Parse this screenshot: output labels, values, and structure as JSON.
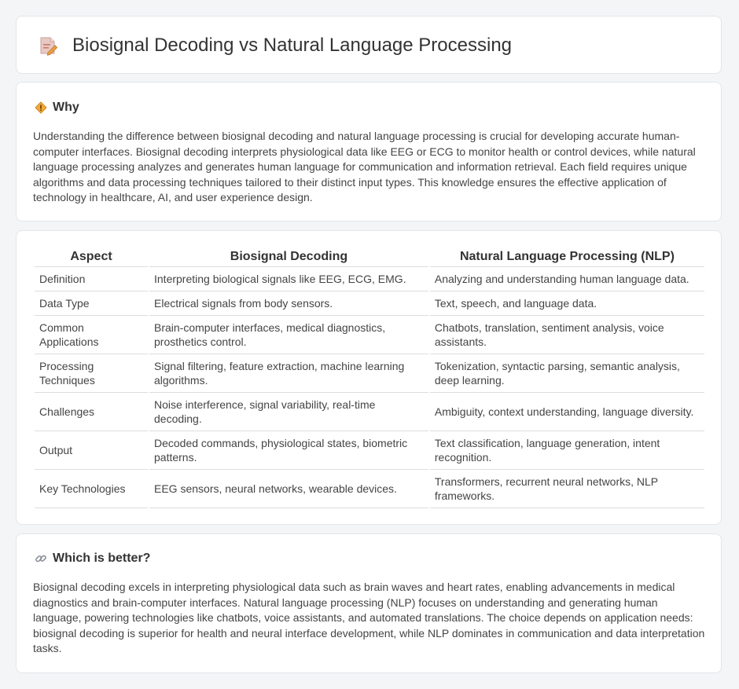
{
  "header": {
    "title": "Biosignal Decoding vs Natural Language Processing",
    "icon": "document-pencil-icon"
  },
  "why": {
    "heading": "Why",
    "icon": "warning-diamond-icon",
    "text": "Understanding the difference between biosignal decoding and natural language processing is crucial for developing accurate human-computer interfaces. Biosignal decoding interprets physiological data like EEG or ECG to monitor health or control devices, while natural language processing analyzes and generates human language for communication and information retrieval. Each field requires unique algorithms and data processing techniques tailored to their distinct input types. This knowledge ensures the effective application of technology in healthcare, AI, and user experience design."
  },
  "table": {
    "headers": [
      "Aspect",
      "Biosignal Decoding",
      "Natural Language Processing (NLP)"
    ],
    "rows": [
      [
        "Definition",
        "Interpreting biological signals like EEG, ECG, EMG.",
        "Analyzing and understanding human language data."
      ],
      [
        "Data Type",
        "Electrical signals from body sensors.",
        "Text, speech, and language data."
      ],
      [
        "Common Applications",
        "Brain-computer interfaces, medical diagnostics, prosthetics control.",
        "Chatbots, translation, sentiment analysis, voice assistants."
      ],
      [
        "Processing Techniques",
        "Signal filtering, feature extraction, machine learning algorithms.",
        "Tokenization, syntactic parsing, semantic analysis, deep learning."
      ],
      [
        "Challenges",
        "Noise interference, signal variability, real-time decoding.",
        "Ambiguity, context understanding, language diversity."
      ],
      [
        "Output",
        "Decoded commands, physiological states, biometric patterns.",
        "Text classification, language generation, intent recognition."
      ],
      [
        "Key Technologies",
        "EEG sensors, neural networks, wearable devices.",
        "Transformers, recurrent neural networks, NLP frameworks."
      ]
    ]
  },
  "better": {
    "heading": "Which is better?",
    "icon": "link-icon",
    "text": "Biosignal decoding excels in interpreting physiological data such as brain waves and heart rates, enabling advancements in medical diagnostics and brain-computer interfaces. Natural language processing (NLP) focuses on understanding and generating human language, powering technologies like chatbots, voice assistants, and automated translations. The choice depends on application needs: biosignal decoding is superior for health and neural interface development, while NLP dominates in communication and data interpretation tasks."
  }
}
